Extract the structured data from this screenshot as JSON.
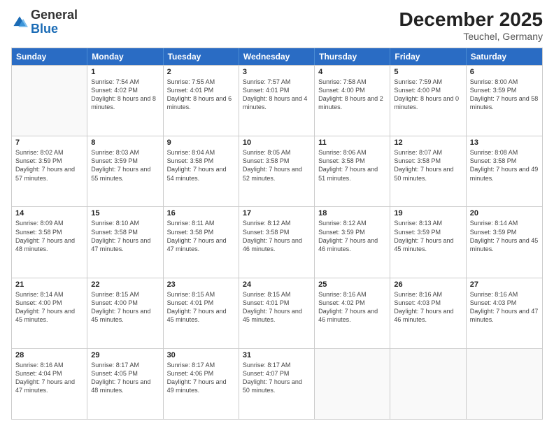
{
  "logo": {
    "general": "General",
    "blue": "Blue"
  },
  "header": {
    "month": "December 2025",
    "location": "Teuchel, Germany"
  },
  "days": [
    "Sunday",
    "Monday",
    "Tuesday",
    "Wednesday",
    "Thursday",
    "Friday",
    "Saturday"
  ],
  "weeks": [
    [
      {
        "day": "",
        "sunrise": "",
        "sunset": "",
        "daylight": ""
      },
      {
        "day": "1",
        "sunrise": "Sunrise: 7:54 AM",
        "sunset": "Sunset: 4:02 PM",
        "daylight": "Daylight: 8 hours and 8 minutes."
      },
      {
        "day": "2",
        "sunrise": "Sunrise: 7:55 AM",
        "sunset": "Sunset: 4:01 PM",
        "daylight": "Daylight: 8 hours and 6 minutes."
      },
      {
        "day": "3",
        "sunrise": "Sunrise: 7:57 AM",
        "sunset": "Sunset: 4:01 PM",
        "daylight": "Daylight: 8 hours and 4 minutes."
      },
      {
        "day": "4",
        "sunrise": "Sunrise: 7:58 AM",
        "sunset": "Sunset: 4:00 PM",
        "daylight": "Daylight: 8 hours and 2 minutes."
      },
      {
        "day": "5",
        "sunrise": "Sunrise: 7:59 AM",
        "sunset": "Sunset: 4:00 PM",
        "daylight": "Daylight: 8 hours and 0 minutes."
      },
      {
        "day": "6",
        "sunrise": "Sunrise: 8:00 AM",
        "sunset": "Sunset: 3:59 PM",
        "daylight": "Daylight: 7 hours and 58 minutes."
      }
    ],
    [
      {
        "day": "7",
        "sunrise": "Sunrise: 8:02 AM",
        "sunset": "Sunset: 3:59 PM",
        "daylight": "Daylight: 7 hours and 57 minutes."
      },
      {
        "day": "8",
        "sunrise": "Sunrise: 8:03 AM",
        "sunset": "Sunset: 3:59 PM",
        "daylight": "Daylight: 7 hours and 55 minutes."
      },
      {
        "day": "9",
        "sunrise": "Sunrise: 8:04 AM",
        "sunset": "Sunset: 3:58 PM",
        "daylight": "Daylight: 7 hours and 54 minutes."
      },
      {
        "day": "10",
        "sunrise": "Sunrise: 8:05 AM",
        "sunset": "Sunset: 3:58 PM",
        "daylight": "Daylight: 7 hours and 52 minutes."
      },
      {
        "day": "11",
        "sunrise": "Sunrise: 8:06 AM",
        "sunset": "Sunset: 3:58 PM",
        "daylight": "Daylight: 7 hours and 51 minutes."
      },
      {
        "day": "12",
        "sunrise": "Sunrise: 8:07 AM",
        "sunset": "Sunset: 3:58 PM",
        "daylight": "Daylight: 7 hours and 50 minutes."
      },
      {
        "day": "13",
        "sunrise": "Sunrise: 8:08 AM",
        "sunset": "Sunset: 3:58 PM",
        "daylight": "Daylight: 7 hours and 49 minutes."
      }
    ],
    [
      {
        "day": "14",
        "sunrise": "Sunrise: 8:09 AM",
        "sunset": "Sunset: 3:58 PM",
        "daylight": "Daylight: 7 hours and 48 minutes."
      },
      {
        "day": "15",
        "sunrise": "Sunrise: 8:10 AM",
        "sunset": "Sunset: 3:58 PM",
        "daylight": "Daylight: 7 hours and 47 minutes."
      },
      {
        "day": "16",
        "sunrise": "Sunrise: 8:11 AM",
        "sunset": "Sunset: 3:58 PM",
        "daylight": "Daylight: 7 hours and 47 minutes."
      },
      {
        "day": "17",
        "sunrise": "Sunrise: 8:12 AM",
        "sunset": "Sunset: 3:58 PM",
        "daylight": "Daylight: 7 hours and 46 minutes."
      },
      {
        "day": "18",
        "sunrise": "Sunrise: 8:12 AM",
        "sunset": "Sunset: 3:59 PM",
        "daylight": "Daylight: 7 hours and 46 minutes."
      },
      {
        "day": "19",
        "sunrise": "Sunrise: 8:13 AM",
        "sunset": "Sunset: 3:59 PM",
        "daylight": "Daylight: 7 hours and 45 minutes."
      },
      {
        "day": "20",
        "sunrise": "Sunrise: 8:14 AM",
        "sunset": "Sunset: 3:59 PM",
        "daylight": "Daylight: 7 hours and 45 minutes."
      }
    ],
    [
      {
        "day": "21",
        "sunrise": "Sunrise: 8:14 AM",
        "sunset": "Sunset: 4:00 PM",
        "daylight": "Daylight: 7 hours and 45 minutes."
      },
      {
        "day": "22",
        "sunrise": "Sunrise: 8:15 AM",
        "sunset": "Sunset: 4:00 PM",
        "daylight": "Daylight: 7 hours and 45 minutes."
      },
      {
        "day": "23",
        "sunrise": "Sunrise: 8:15 AM",
        "sunset": "Sunset: 4:01 PM",
        "daylight": "Daylight: 7 hours and 45 minutes."
      },
      {
        "day": "24",
        "sunrise": "Sunrise: 8:15 AM",
        "sunset": "Sunset: 4:01 PM",
        "daylight": "Daylight: 7 hours and 45 minutes."
      },
      {
        "day": "25",
        "sunrise": "Sunrise: 8:16 AM",
        "sunset": "Sunset: 4:02 PM",
        "daylight": "Daylight: 7 hours and 46 minutes."
      },
      {
        "day": "26",
        "sunrise": "Sunrise: 8:16 AM",
        "sunset": "Sunset: 4:03 PM",
        "daylight": "Daylight: 7 hours and 46 minutes."
      },
      {
        "day": "27",
        "sunrise": "Sunrise: 8:16 AM",
        "sunset": "Sunset: 4:03 PM",
        "daylight": "Daylight: 7 hours and 47 minutes."
      }
    ],
    [
      {
        "day": "28",
        "sunrise": "Sunrise: 8:16 AM",
        "sunset": "Sunset: 4:04 PM",
        "daylight": "Daylight: 7 hours and 47 minutes."
      },
      {
        "day": "29",
        "sunrise": "Sunrise: 8:17 AM",
        "sunset": "Sunset: 4:05 PM",
        "daylight": "Daylight: 7 hours and 48 minutes."
      },
      {
        "day": "30",
        "sunrise": "Sunrise: 8:17 AM",
        "sunset": "Sunset: 4:06 PM",
        "daylight": "Daylight: 7 hours and 49 minutes."
      },
      {
        "day": "31",
        "sunrise": "Sunrise: 8:17 AM",
        "sunset": "Sunset: 4:07 PM",
        "daylight": "Daylight: 7 hours and 50 minutes."
      },
      {
        "day": "",
        "sunrise": "",
        "sunset": "",
        "daylight": ""
      },
      {
        "day": "",
        "sunrise": "",
        "sunset": "",
        "daylight": ""
      },
      {
        "day": "",
        "sunrise": "",
        "sunset": "",
        "daylight": ""
      }
    ]
  ]
}
